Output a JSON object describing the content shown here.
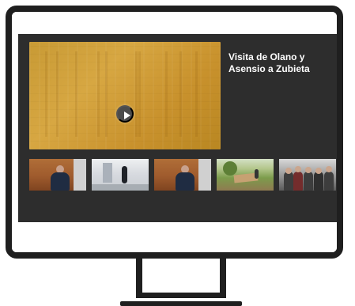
{
  "featured": {
    "title": "Visita de Olano y Asensio a Zubieta",
    "description": ""
  },
  "thumbnails": [
    {
      "caption": "",
      "icon": "speaker-thumbnail"
    },
    {
      "caption": "",
      "icon": "corridor-thumbnail"
    },
    {
      "caption": "",
      "icon": "speaker-thumbnail"
    },
    {
      "caption": "",
      "icon": "outdoor-thumbnail"
    },
    {
      "caption": "",
      "icon": "group-thumbnail"
    }
  ],
  "colors": {
    "frame": "#1f1f1f",
    "screen_background": "#2d2d2d",
    "featured_accent": "#d7a742",
    "title_text": "#ffffff",
    "description_text": "#8b8b8b",
    "caption_text": "#c8c8c8"
  },
  "icons": {
    "play": "play-icon"
  }
}
